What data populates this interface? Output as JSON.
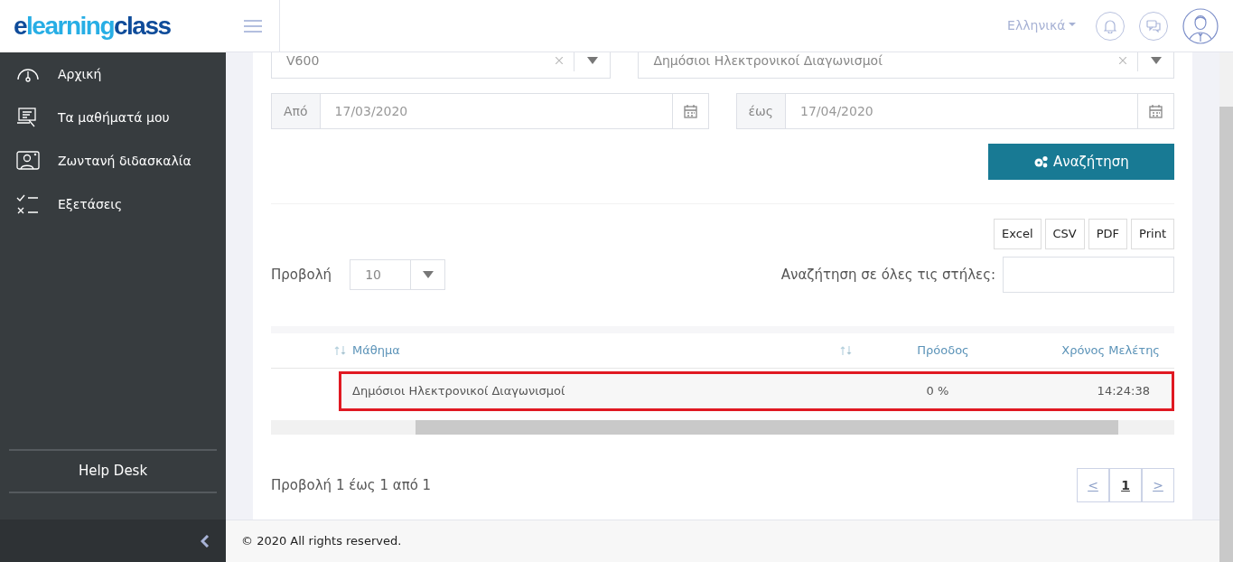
{
  "logo": {
    "parts": [
      "e",
      "learning",
      "class"
    ]
  },
  "header": {
    "language": "Ελληνικά"
  },
  "sidebar": {
    "items": [
      {
        "label": "Αρχική"
      },
      {
        "label": "Τα μαθήματά μου"
      },
      {
        "label": "Ζωντανή διδασκαλία"
      },
      {
        "label": "Εξετάσεις"
      }
    ],
    "help": "Help Desk"
  },
  "filters": {
    "select_1": "V600",
    "select_2": "Δημόσιοι Ηλεκτρονικοί Διαγωνισμοί",
    "from_label": "Από",
    "from_value": "17/03/2020",
    "to_label": "έως",
    "to_value": "17/04/2020",
    "search_button": "Αναζήτηση"
  },
  "export_buttons": [
    "Excel",
    "CSV",
    "PDF",
    "Print"
  ],
  "length": {
    "label": "Προβολή",
    "value": "10"
  },
  "global_search": {
    "label": "Αναζήτηση σε όλες τις στήλες:"
  },
  "table": {
    "columns": [
      "Μάθημα",
      "Πρόοδος",
      "Χρόνος Μελέτης"
    ],
    "rows": [
      {
        "course": "Δημόσιοι Ηλεκτρονικοί Διαγωνισμοί",
        "progress": "0 %",
        "time": "14:24:38",
        "highlighted": true
      }
    ]
  },
  "info": "Προβολή 1 έως 1 από 1",
  "pagination": {
    "prev": "<",
    "pages": [
      {
        "label": "1",
        "selected": true
      }
    ],
    "next": ">"
  },
  "footer": "© 2020 All rights reserved."
}
